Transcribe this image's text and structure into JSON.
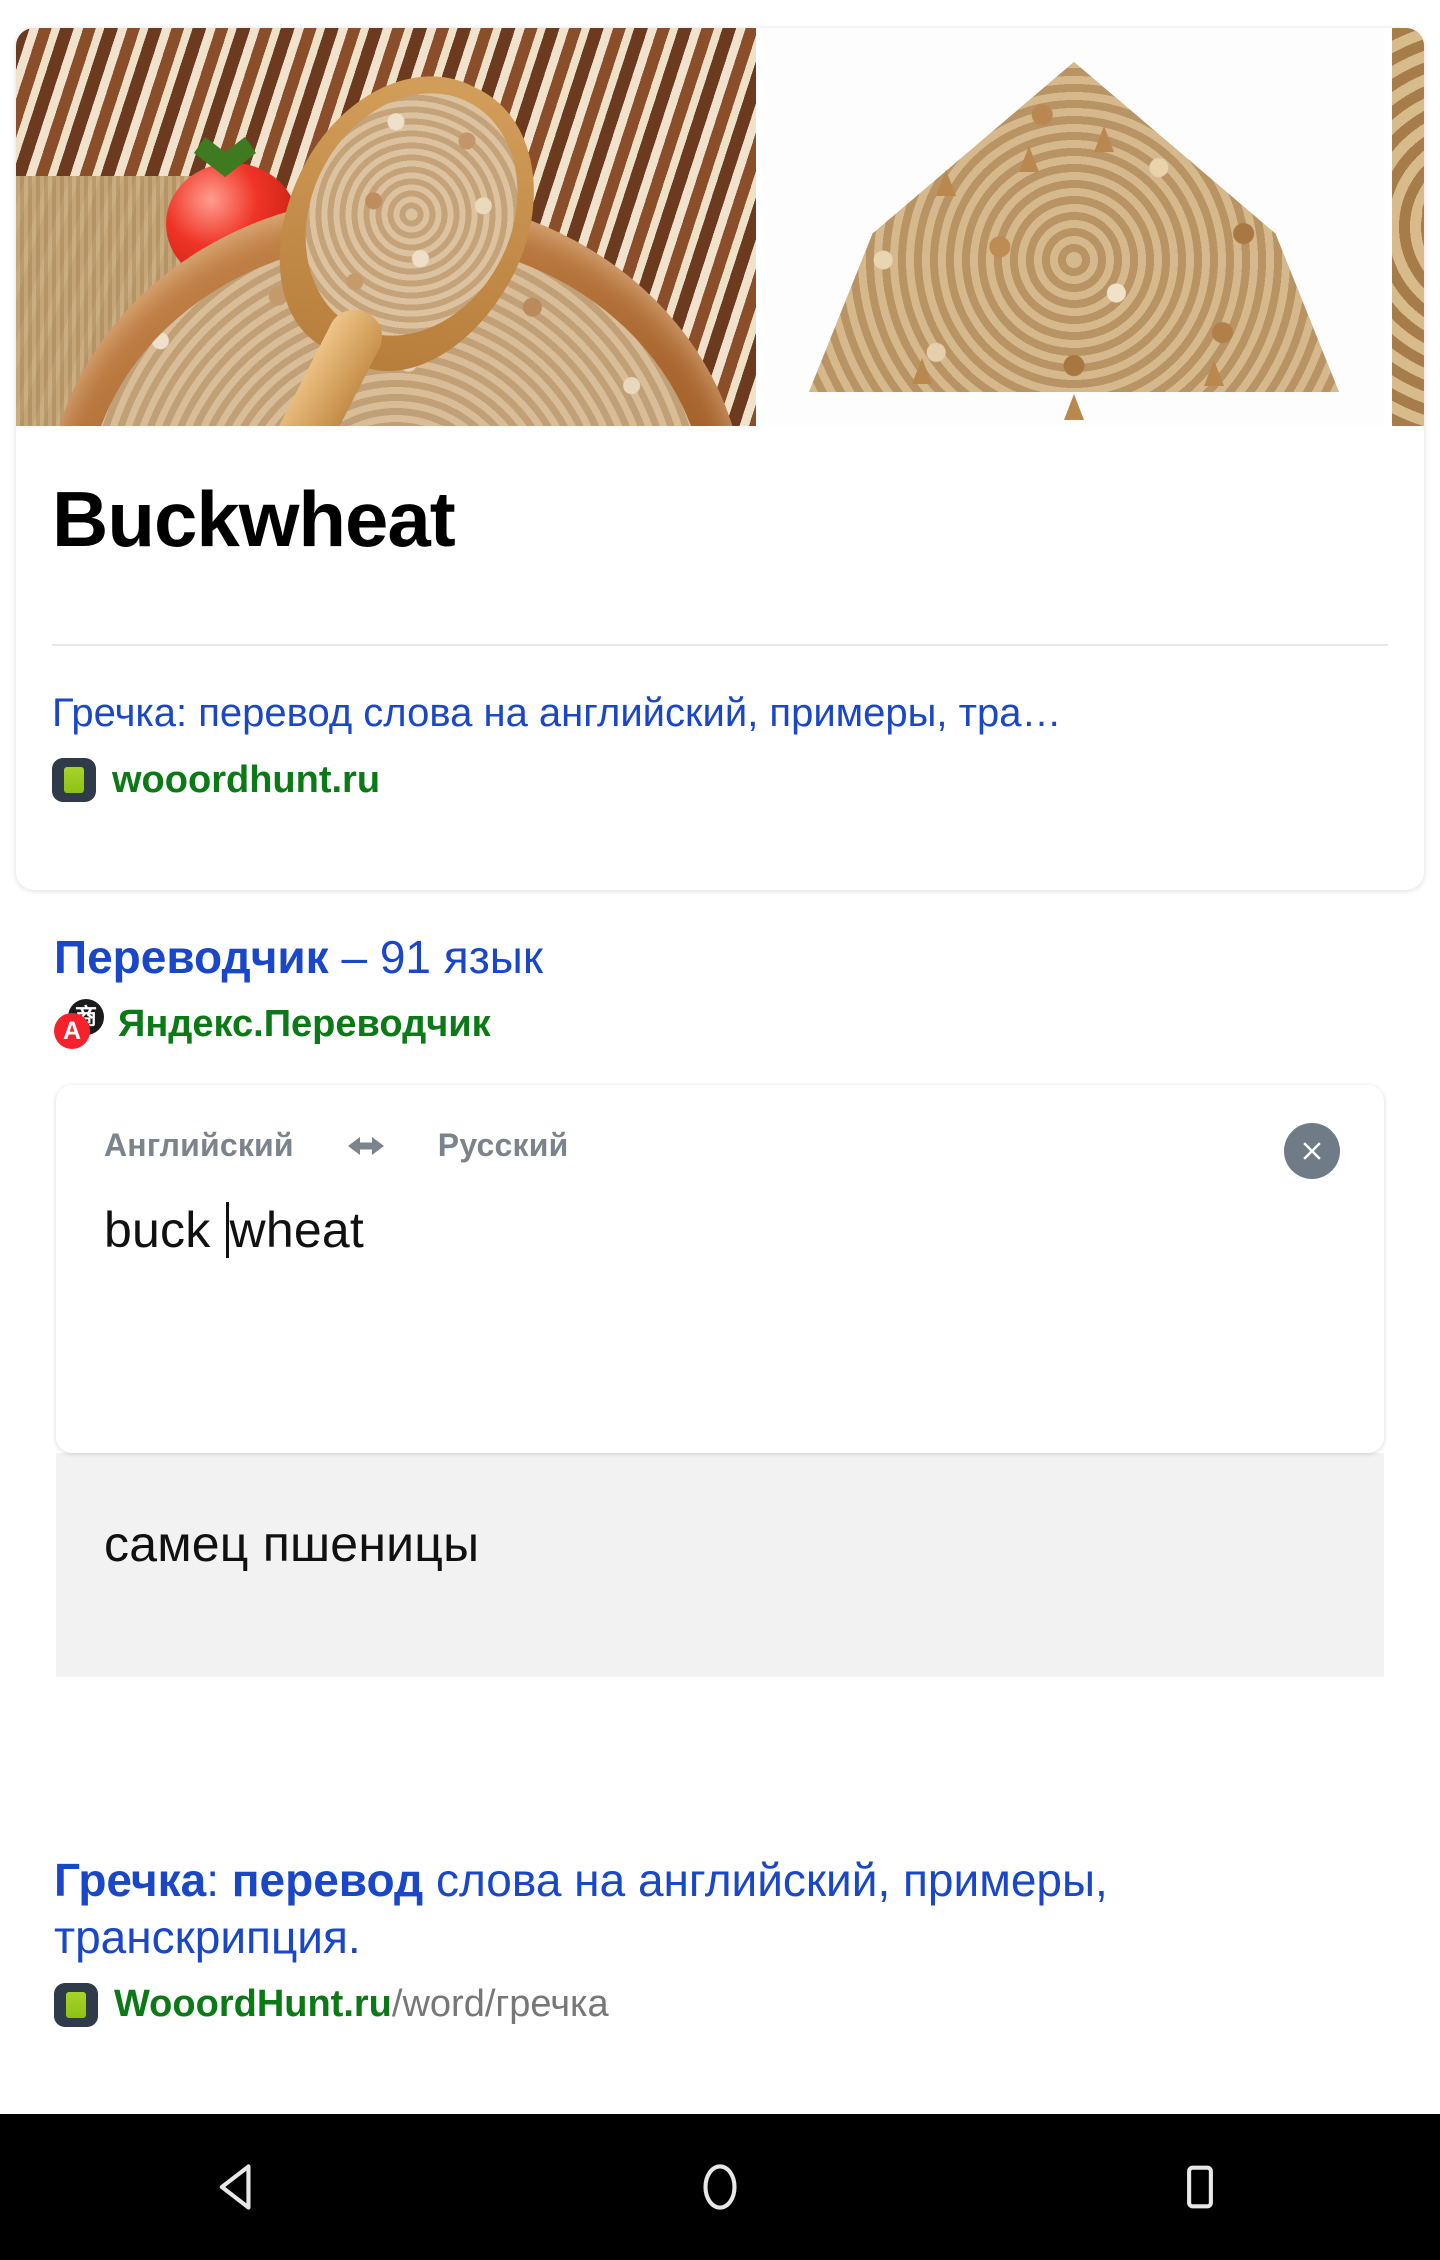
{
  "hero": {
    "images": [
      {
        "alt": "cooked buckwheat in wooden bowl with spoon, tomato and basil"
      },
      {
        "alt": "pile of raw buckwheat groats on white background"
      },
      {
        "alt": "close-up of buckwheat grains"
      }
    ],
    "title": "Buckwheat",
    "result_title": "Гречка: перевод слова на английский, примеры, тра…",
    "sitename": "wooordhunt.ru"
  },
  "translator": {
    "heading_bold": "Переводчик",
    "heading_rest": " – 91 язык",
    "source_name": "Яндекс.Переводчик",
    "source_lang": "Английский",
    "target_lang": "Русский",
    "swap_icon": "swap-horizontal-icon",
    "clear_icon": "close-circle-icon",
    "input_before_caret": "buck ",
    "input_after_caret": "wheat",
    "input_value": "buck wheat",
    "output_value": "самец пшеницы",
    "yandex_dark_glyph": "商",
    "yandex_red_glyph": "A"
  },
  "organic": {
    "title_part1": "Гречка",
    "title_part2": ": ",
    "title_part3": "перевод",
    "title_part4": " слова на английский, примеры, транскрипция.",
    "sitename": "WooordHunt.ru",
    "sitepath": "/word/гречка"
  },
  "navbar": {
    "back": "back-triangle-icon",
    "home": "home-circle-icon",
    "recents": "recents-square-icon"
  },
  "colors": {
    "link_blue": "#1a46c8",
    "site_green": "#0b7a16",
    "lang_gray": "#7b838c",
    "clear_gray": "#6f7b86",
    "output_bg": "#f2f2f2"
  }
}
